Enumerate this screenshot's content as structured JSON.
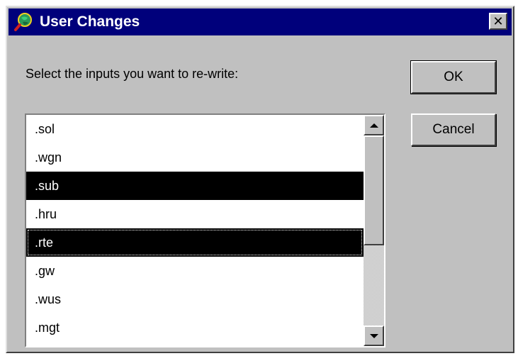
{
  "dialog": {
    "title": "User Changes",
    "close_glyph": "✕",
    "prompt": "Select the inputs you want to re-write:"
  },
  "buttons": {
    "ok_label": "OK",
    "cancel_label": "Cancel"
  },
  "list": {
    "items": [
      {
        "label": ".sol",
        "selected": false
      },
      {
        "label": ".wgn",
        "selected": false
      },
      {
        "label": ".sub",
        "selected": true
      },
      {
        "label": ".hru",
        "selected": false
      },
      {
        "label": ".rte",
        "selected": true,
        "focused": true
      },
      {
        "label": ".gw",
        "selected": false
      },
      {
        "label": ".wus",
        "selected": false
      },
      {
        "label": ".mgt",
        "selected": false
      }
    ]
  },
  "icons": {
    "app": "magnifier-globe-icon",
    "close": "close-icon",
    "scroll_up": "scroll-up-arrow-icon",
    "scroll_down": "scroll-down-arrow-icon"
  },
  "colors": {
    "titlebar": "#00007b",
    "face": "#c0c0c0",
    "selection": "#000000"
  }
}
